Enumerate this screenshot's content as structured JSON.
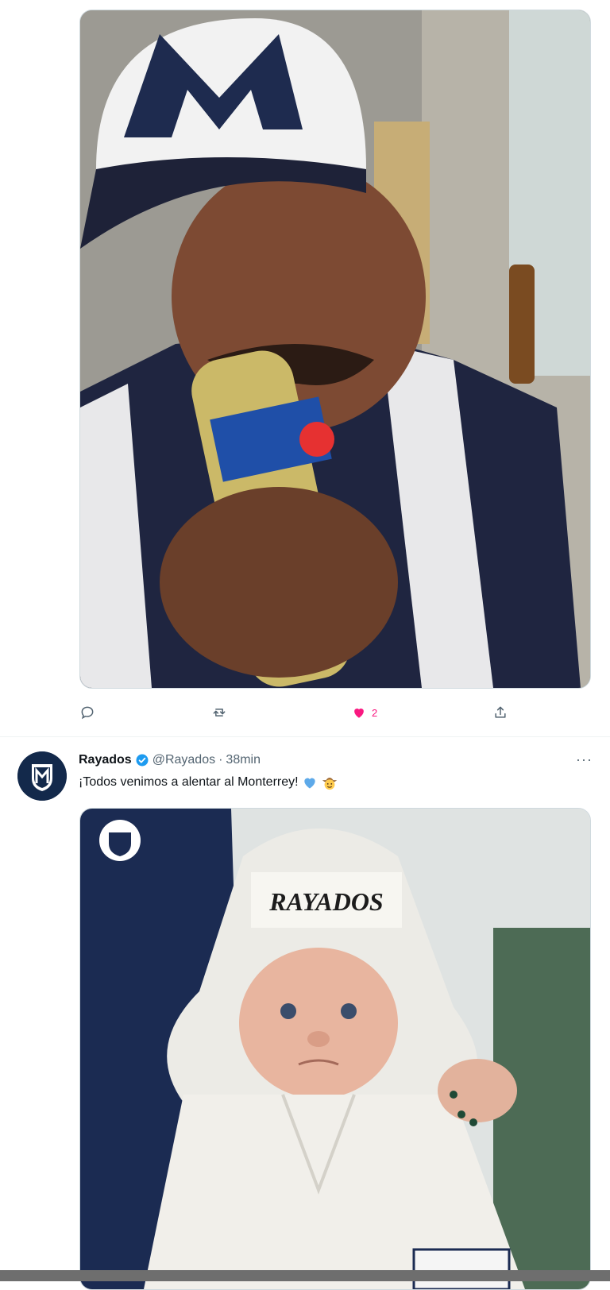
{
  "tweet1": {
    "image_alt": "Fan in Monterrey cap and striped jersey drinking from a Pepsi bottle",
    "actions": {
      "reply_count": "",
      "retweet_count": "",
      "like_count": "2",
      "liked": true
    }
  },
  "tweet2": {
    "author_name": "Rayados",
    "handle": "@Rayados",
    "separator": "·",
    "time": "38min",
    "text": "¡Todos venimos a alentar al Monterrey!",
    "emojis": [
      "blue-heart",
      "cowboy-face"
    ],
    "more_label": "···",
    "image_caption_text": "RAYADOS",
    "image_alt": "Fan holding a cardboard cutout of a baby in a white hooded robe with RAYADOS logo"
  },
  "colors": {
    "like_pink": "#f91880",
    "verified_blue": "#1d9bf0",
    "muted_gray": "#536471",
    "team_navy": "#13294b"
  }
}
